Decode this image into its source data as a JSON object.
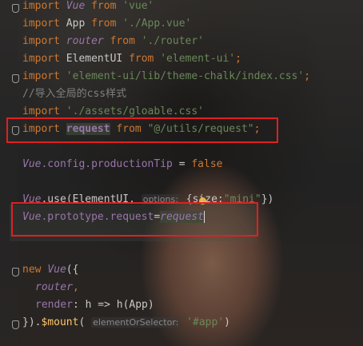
{
  "editor": {
    "lines": [
      {
        "parts": [
          "import",
          "Vue",
          "from",
          "'vue'"
        ]
      },
      {
        "parts": [
          "import",
          "App",
          "from",
          "'./App.vue'"
        ]
      },
      {
        "parts": [
          "import",
          "router",
          "from",
          "'./router'"
        ]
      },
      {
        "parts": [
          "import",
          "ElementUI",
          "from",
          "'element-ui'",
          ";"
        ]
      },
      {
        "parts": [
          "import",
          "'element-ui/lib/theme-chalk/index.css'",
          ";"
        ]
      },
      {
        "parts": [
          "//导入全局的css样式"
        ]
      },
      {
        "parts": [
          "import",
          "'./assets/gloable.css'"
        ]
      },
      {
        "parts": [
          "import",
          "request",
          "from",
          "\"@/utils/request\"",
          ";"
        ]
      },
      {
        "parts": [
          "Vue",
          ".config.productionTip",
          "=",
          "false"
        ]
      },
      {
        "parts": [
          "Vue",
          ".use(ElementUI,",
          "options:",
          "{size:",
          "\"mini\"",
          "})"
        ]
      },
      {
        "parts": [
          "Vue",
          ".prototype.",
          "request",
          "=",
          "request"
        ]
      },
      {
        "parts": [
          "new",
          "Vue",
          "({"
        ]
      },
      {
        "parts": [
          "router",
          ","
        ]
      },
      {
        "parts": [
          "render",
          ": h => h(App)"
        ]
      },
      {
        "parts": [
          "}).",
          "$mount",
          "(",
          "elementOrSelector:",
          "'#app'",
          ")"
        ]
      }
    ]
  },
  "colors": {
    "keyword": "#cc7832",
    "string": "#6a8759",
    "identifier_purple": "#9876aa",
    "function": "#ffc66d",
    "annotation_box": "#e02020"
  },
  "icons": [
    "fold-marker-icon",
    "intention-bulb-icon"
  ]
}
